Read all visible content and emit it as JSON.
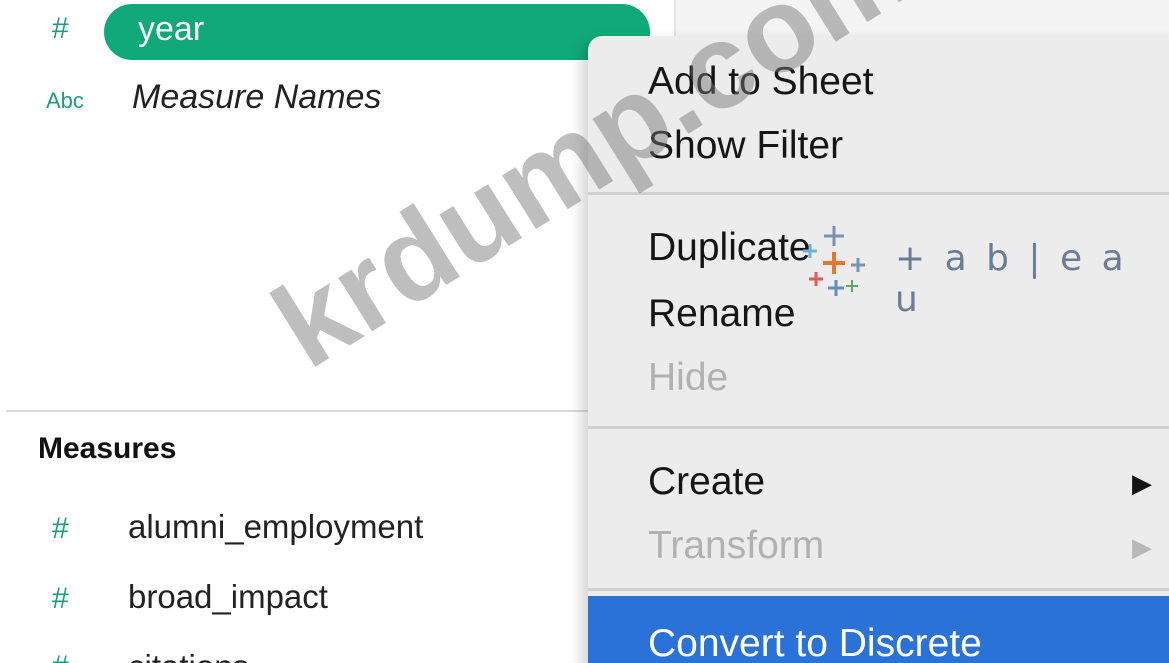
{
  "dimensions": {
    "items": [
      {
        "type_icon": "#",
        "label": "year",
        "selected": true
      },
      {
        "type_icon": "Abc",
        "label": "Measure Names",
        "italic": true
      }
    ]
  },
  "measures": {
    "title": "Measures",
    "items": [
      {
        "type_icon": "#",
        "label": "alumni_employment"
      },
      {
        "type_icon": "#",
        "label": "broad_impact"
      },
      {
        "type_icon": "#",
        "label": "citations"
      }
    ]
  },
  "context_menu": {
    "groups": [
      [
        {
          "label": "Add to Sheet",
          "enabled": true
        },
        {
          "label": "Show Filter",
          "enabled": true
        }
      ],
      [
        {
          "label": "Duplicate",
          "enabled": true
        },
        {
          "label": "Rename",
          "enabled": true
        },
        {
          "label": "Hide",
          "enabled": false
        }
      ],
      [
        {
          "label": "Create",
          "enabled": true,
          "submenu": true
        },
        {
          "label": "Transform",
          "enabled": false,
          "submenu": true
        }
      ],
      [
        {
          "label": "Convert to Discrete",
          "enabled": true,
          "highlighted": true
        }
      ]
    ],
    "submenu_arrow": "▶"
  },
  "overlay": {
    "logo_text": "+ a b | e a u",
    "watermark": "krdump.com"
  },
  "colors": {
    "selected_pill": "#11a979",
    "field_icon": "#1d9e7a",
    "highlight": "#2a72d7",
    "disabled_text": "#b1b1b1"
  }
}
